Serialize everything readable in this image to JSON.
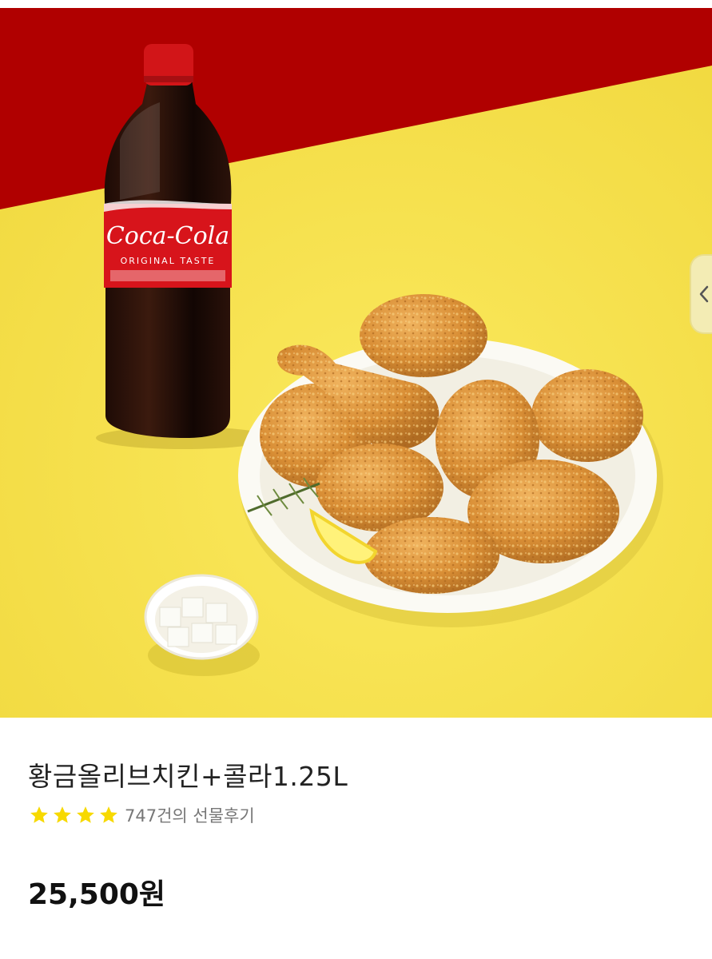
{
  "product": {
    "image_alt": "Coca-Cola ORIGINAL TASTE",
    "title": "황금올리브치킨+콜라1.25L",
    "rating": {
      "stars": 4,
      "review_text": "747건의 선물후기"
    },
    "price": "25,500원"
  },
  "controls": {
    "prev_icon": "chevron-left-icon"
  },
  "colors": {
    "background_red": "#b00000",
    "background_yellow": "#f6e04a",
    "star": "#f7d900"
  }
}
